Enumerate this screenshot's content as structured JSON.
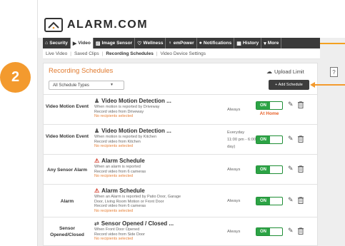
{
  "brand": {
    "name": "ALARM.COM",
    "suffix": "·"
  },
  "nav": {
    "tabs": [
      {
        "label": "Security",
        "icon": "home-icon",
        "glyph": "⌂",
        "active": false
      },
      {
        "label": "Video",
        "icon": "video-icon",
        "glyph": "▶",
        "active": true
      },
      {
        "label": "Image Sensor",
        "icon": "image-icon",
        "glyph": "▨",
        "active": false
      },
      {
        "label": "Wellness",
        "icon": "heart-icon",
        "glyph": "♡",
        "active": false
      },
      {
        "label": "emPower",
        "icon": "bulb-icon",
        "glyph": "♀",
        "active": false
      },
      {
        "label": "Notifications",
        "icon": "chat-icon",
        "glyph": "●",
        "active": false
      },
      {
        "label": "History",
        "icon": "calendar-icon",
        "glyph": "▦",
        "active": false
      },
      {
        "label": "More",
        "icon": "chevron-down-icon",
        "glyph": "▾",
        "active": false
      }
    ]
  },
  "subnav": {
    "items": [
      "Live Video",
      "Saved Clips",
      "Recording Schedules",
      "Video Device Settings"
    ],
    "active_index": 2
  },
  "step_number": "2",
  "help_label": "?",
  "panel": {
    "title": "Recording Schedules",
    "upload_label": "Upload Limit",
    "filter_value": "All Schedule Types",
    "add_label": "+ Add Schedule"
  },
  "rows": [
    {
      "type": "Video Motion Event",
      "icon": "motion-icon",
      "title": "Video Motion Detection ...",
      "desc": [
        "When motion is reported by Driveway",
        "Record video from Driveway"
      ],
      "note": "No recipients selected",
      "schedule": [
        "Always"
      ],
      "toggle": "ON",
      "mode": "At Home"
    },
    {
      "type": "Video Motion Event",
      "icon": "motion-icon",
      "title": "Video Motion Detection ...",
      "desc": [
        "When motion is reported by Kitchen",
        "Record video from Kitchen"
      ],
      "note": "No recipients selected",
      "schedule": [
        "Everyday",
        "11:00 pm - 6:00 am (next",
        "day)"
      ],
      "toggle": "ON",
      "mode": ""
    },
    {
      "type": "Any Sensor Alarm",
      "icon": "warning-icon",
      "title": "Alarm Schedule",
      "desc": [
        "When an alarm is reported",
        "Record video from 6 cameras"
      ],
      "note": "No recipients selected",
      "schedule": [
        "Always"
      ],
      "toggle": "ON",
      "mode": ""
    },
    {
      "type": "Alarm",
      "icon": "warning-icon",
      "title": "Alarm Schedule",
      "desc": [
        "When an Alarm is reported by Patio Door, Garage",
        "Door, Living Room Motion or Front Door",
        "Record video from 6 cameras"
      ],
      "note": "No recipients selected",
      "schedule": [
        "Always"
      ],
      "toggle": "ON",
      "mode": ""
    },
    {
      "type": "Sensor Opened/Closed",
      "icon": "swap-icon",
      "title": "Sensor Opened / Closed ...",
      "desc": [
        "When Front Door Opened",
        "Record video from Side Door"
      ],
      "note": "No recipients selected",
      "schedule": [
        "Always"
      ],
      "toggle": "ON",
      "mode": ""
    }
  ]
}
